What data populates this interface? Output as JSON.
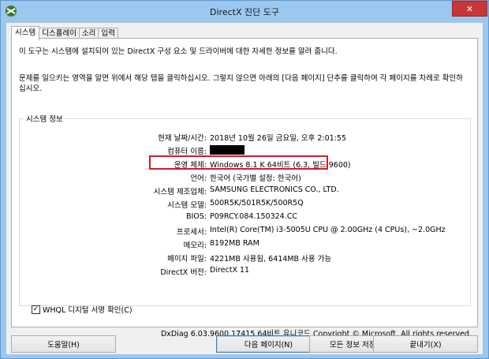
{
  "window": {
    "title": "DirectX 진단 도구"
  },
  "title_controls": {
    "minimize": "—",
    "maximize": "□",
    "close": "✕"
  },
  "tabs": [
    {
      "label": "시스템",
      "active": true
    },
    {
      "label": "디스플레이"
    },
    {
      "label": "소리"
    },
    {
      "label": "입력"
    }
  ],
  "intro": {
    "line1": "이 도구는 시스템에 설치되어 있는 DirectX 구성 요소 및 드라이버에 대한 자세한 정보를 알려 줍니다.",
    "line2": "문제를 일으키는 영역을 알면 위에서 해당 탭을 클릭하십시오. 그렇지 않으면 아래의 [다음 페이지] 단추를 클릭하여 각 페이지를 차례로 확인하십시오."
  },
  "system_info": {
    "group_label": "시스템 정보",
    "rows": [
      {
        "label": "현재 날짜/시간:",
        "value": "2018년 10월 26일 금요일, 오후 2:01:55"
      },
      {
        "label": "컴퓨터 이름:",
        "value": ""
      },
      {
        "label": "운영 체제:",
        "value": "Windows 8.1 K 64비트 (6.3, 빌드 9600)"
      },
      {
        "label": "언어:",
        "value": "한국어 (국가별 설정: 한국어)"
      },
      {
        "label": "시스템 제조업체:",
        "value": "SAMSUNG ELECTRONICS CO., LTD."
      },
      {
        "label": "시스템 모델:",
        "value": "500R5K/501R5K/500R5Q"
      },
      {
        "label": "BIOS:",
        "value": "P09RCY.084.150324.CC"
      },
      {
        "label": "프로세서:",
        "value": "Intel(R) Core(TM) i3-5005U CPU @ 2.00GHz (4 CPUs), ~2.0GHz"
      },
      {
        "label": "메모리:",
        "value": "8192MB RAM"
      },
      {
        "label": "페이지 파일:",
        "value": "4221MB 사용됨, 6414MB 사용 가능"
      },
      {
        "label": "DirectX 버전:",
        "value": "DirectX 11"
      }
    ]
  },
  "whql": {
    "label": "WHQL 디지털 서명 확인(C)",
    "checked": true,
    "check_glyph": "✓"
  },
  "footer_text": "DxDiag 6.03.9600.17415 64비트 유니코드  Copyright © Microsoft. All rights reserved.",
  "buttons": {
    "help": "도움말(H)",
    "next": "다음 페이지(N)",
    "save": "모든 정보 저장(S)...",
    "exit": "끝내기(X)"
  }
}
